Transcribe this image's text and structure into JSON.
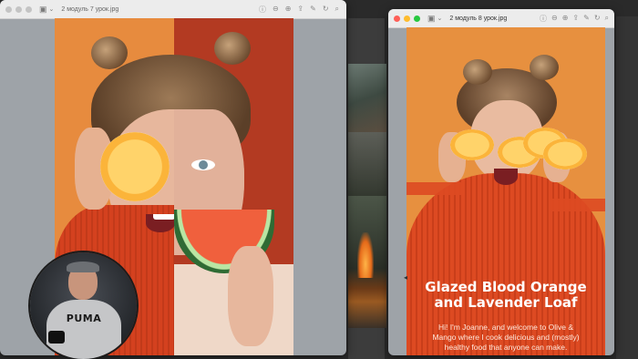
{
  "windows": [
    {
      "title": "2 модуль 7 урок.jpg",
      "toolbar_icons": [
        "sidebar-icon",
        "info-icon",
        "zoom-out-icon",
        "zoom-in-icon",
        "share-icon",
        "markup-icon",
        "rotate-icon",
        "search-icon"
      ]
    },
    {
      "title": "2 модуль 8 урок.jpg",
      "toolbar_icons": [
        "sidebar-icon",
        "info-icon",
        "zoom-out-icon",
        "zoom-in-icon",
        "share-icon",
        "markup-icon",
        "rotate-icon",
        "search-icon"
      ]
    }
  ],
  "poster": {
    "headline_line1": "Glazed Blood Orange",
    "headline_line2": "and Lavender Loaf",
    "intro_line1": "Hi! I'm Joanne, and welcome to Olive &",
    "intro_line2": "Mango where I cook delicious and (mostly)",
    "intro_line3": "healthy food that anyone can make."
  },
  "webcam": {
    "shirt_text": "PUMA"
  },
  "colors": {
    "orange_bg": "#e78b3e",
    "red_bg": "#b33a22",
    "sweater": "#d4411f",
    "window_bg": "#9ea3a8"
  }
}
